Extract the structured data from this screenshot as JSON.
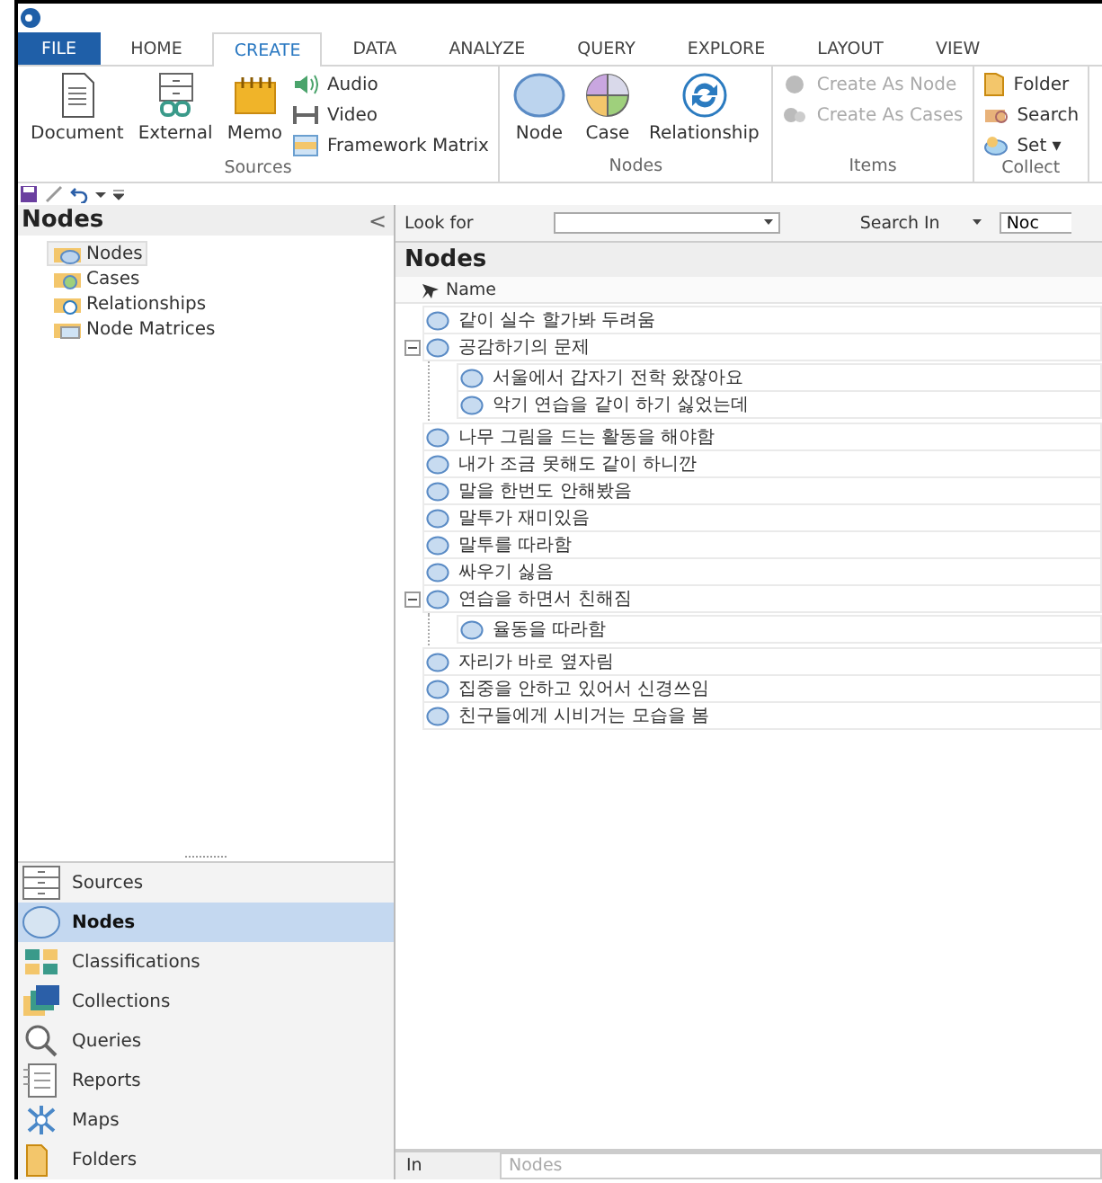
{
  "ribbon": {
    "tabs": [
      {
        "label": "FILE",
        "kind": "file",
        "selected": false
      },
      {
        "label": "HOME",
        "kind": "tab",
        "selected": false
      },
      {
        "label": "CREATE",
        "kind": "tab",
        "selected": true
      },
      {
        "label": "DATA",
        "kind": "tab",
        "selected": false
      },
      {
        "label": "ANALYZE",
        "kind": "tab",
        "selected": false
      },
      {
        "label": "QUERY",
        "kind": "tab",
        "selected": false
      },
      {
        "label": "EXPLORE",
        "kind": "tab",
        "selected": false
      },
      {
        "label": "LAYOUT",
        "kind": "tab",
        "selected": false
      },
      {
        "label": "VIEW",
        "kind": "tab",
        "selected": false
      }
    ],
    "groups": [
      {
        "label": "Sources",
        "items": [
          {
            "label": "Document",
            "kind": "large",
            "disabled": false
          },
          {
            "label": "External",
            "kind": "large",
            "disabled": false
          },
          {
            "label": "Memo",
            "kind": "large",
            "disabled": false
          },
          {
            "label": "Audio",
            "kind": "small",
            "disabled": false
          },
          {
            "label": "Video",
            "kind": "small",
            "disabled": false
          },
          {
            "label": "Framework Matrix",
            "kind": "small",
            "disabled": false
          }
        ]
      },
      {
        "label": "Nodes",
        "items": [
          {
            "label": "Node",
            "kind": "large",
            "disabled": false
          },
          {
            "label": "Case",
            "kind": "large",
            "disabled": false
          },
          {
            "label": "Relationship",
            "kind": "large",
            "disabled": false
          }
        ]
      },
      {
        "label": "Items",
        "items": [
          {
            "label": "Create As Node",
            "kind": "small",
            "disabled": true
          },
          {
            "label": "Create As Cases",
            "kind": "small",
            "disabled": true
          }
        ]
      },
      {
        "label": "Collect",
        "items": [
          {
            "label": "Folder",
            "kind": "small",
            "disabled": false
          },
          {
            "label": "Search",
            "kind": "small",
            "disabled": false
          },
          {
            "label": "Set ▾",
            "kind": "small",
            "disabled": false
          }
        ]
      }
    ]
  },
  "navigator": {
    "title": "Nodes",
    "collapse": "<",
    "items": [
      {
        "label": "Nodes",
        "selected": true
      },
      {
        "label": "Cases",
        "selected": false
      },
      {
        "label": "Relationships",
        "selected": false
      },
      {
        "label": "Node Matrices",
        "selected": false
      }
    ],
    "buttons": [
      {
        "label": "Sources",
        "selected": false
      },
      {
        "label": "Nodes",
        "selected": true
      },
      {
        "label": "Classifications",
        "selected": false
      },
      {
        "label": "Collections",
        "selected": false
      },
      {
        "label": "Queries",
        "selected": false
      },
      {
        "label": "Reports",
        "selected": false
      },
      {
        "label": "Maps",
        "selected": false
      },
      {
        "label": "Folders",
        "selected": false
      }
    ]
  },
  "find_bar": {
    "look_for_label": "Look for",
    "search_in_label": "Search In",
    "search_in_value": "Noc"
  },
  "list": {
    "title": "Nodes",
    "column": "Name",
    "rows": [
      {
        "name": "같이 실수 할가봐 두려움"
      },
      {
        "name": "공감하기의 문제",
        "expanded": true,
        "children": [
          {
            "name": "서울에서 갑자기 전학 왔잖아요"
          },
          {
            "name": "악기 연습을 같이 하기 싫었는데"
          }
        ]
      },
      {
        "name": "나무 그림을 드는 활동을 해야함"
      },
      {
        "name": "내가 조금 못해도 같이 하니깐"
      },
      {
        "name": "말을 한번도 안해봤음"
      },
      {
        "name": "말투가 재미있음"
      },
      {
        "name": "말투를 따라함"
      },
      {
        "name": "싸우기 싫음"
      },
      {
        "name": "연습을 하면서 친해짐",
        "expanded": true,
        "children": [
          {
            "name": "율동을 따라함"
          }
        ]
      },
      {
        "name": "자리가 바로 옆자림"
      },
      {
        "name": "집중을 안하고 있어서 신경쓰임"
      },
      {
        "name": "친구들에게 시비거는 모습을 봄"
      }
    ]
  },
  "status": {
    "label": "In",
    "placeholder": "Nodes"
  }
}
